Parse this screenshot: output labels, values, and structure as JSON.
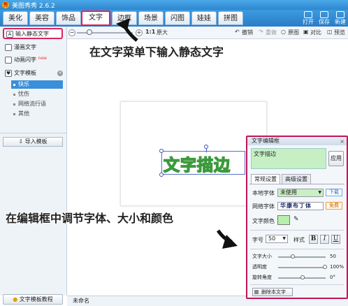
{
  "window": {
    "title": "美图秀秀 2.6.2"
  },
  "tabs": [
    {
      "label": "美化"
    },
    {
      "label": "美容"
    },
    {
      "label": "饰品"
    },
    {
      "label": "文字"
    },
    {
      "label": "边框"
    },
    {
      "label": "场景"
    },
    {
      "label": "闪图"
    },
    {
      "label": "娃娃"
    },
    {
      "label": "拼图"
    }
  ],
  "toolbar_right": {
    "open": "打开",
    "save": "保存",
    "new": "新建"
  },
  "subbar": {
    "zoom_ratio": "1:1",
    "original_size": "原大",
    "undo": "撤销",
    "redo": "重做",
    "original": "原图",
    "compare": "对比",
    "preview": "预览"
  },
  "sidebar": {
    "static_text": "输入静态文字",
    "comic_text": "漫画文字",
    "animated_text": "动画闪字",
    "new_badge": "new",
    "templates": "文字模板",
    "template_items": [
      "快乐",
      "忧伤",
      "网络流行语",
      "其他"
    ],
    "import_template": "导入模板",
    "tutorial": "文字模板教程"
  },
  "canvas": {
    "text": "文字描边"
  },
  "status": {
    "filename": "未命名"
  },
  "panel": {
    "title": "文字编辑框",
    "input_value": "文字描边",
    "apply": "应用",
    "tab_general": "常规设置",
    "tab_advanced": "高级设置",
    "local_font_label": "本地字体",
    "local_font_value": "未使用",
    "download": "下载",
    "web_font_label": "网络字体",
    "web_font_value": "华康布丁体",
    "free": "免费",
    "color_label": "文字颜色",
    "text_color": "#b7f0ad",
    "size_label": "字号",
    "size_value": "50",
    "style_label": "样式",
    "style_bold": "B",
    "style_italic": "I",
    "style_underline": "U",
    "font_size_label": "文字大小",
    "font_size_value": "50",
    "opacity_label": "透明度",
    "opacity_value": "100%",
    "opacity_level": 1.0,
    "rotation_label": "旋转角度",
    "rotation_value": "0°",
    "delete": "删除本文字"
  },
  "annotations": {
    "top": "在文字菜单下输入静态文字",
    "bottom": "在编辑框中调节字体、大小和颜色"
  }
}
